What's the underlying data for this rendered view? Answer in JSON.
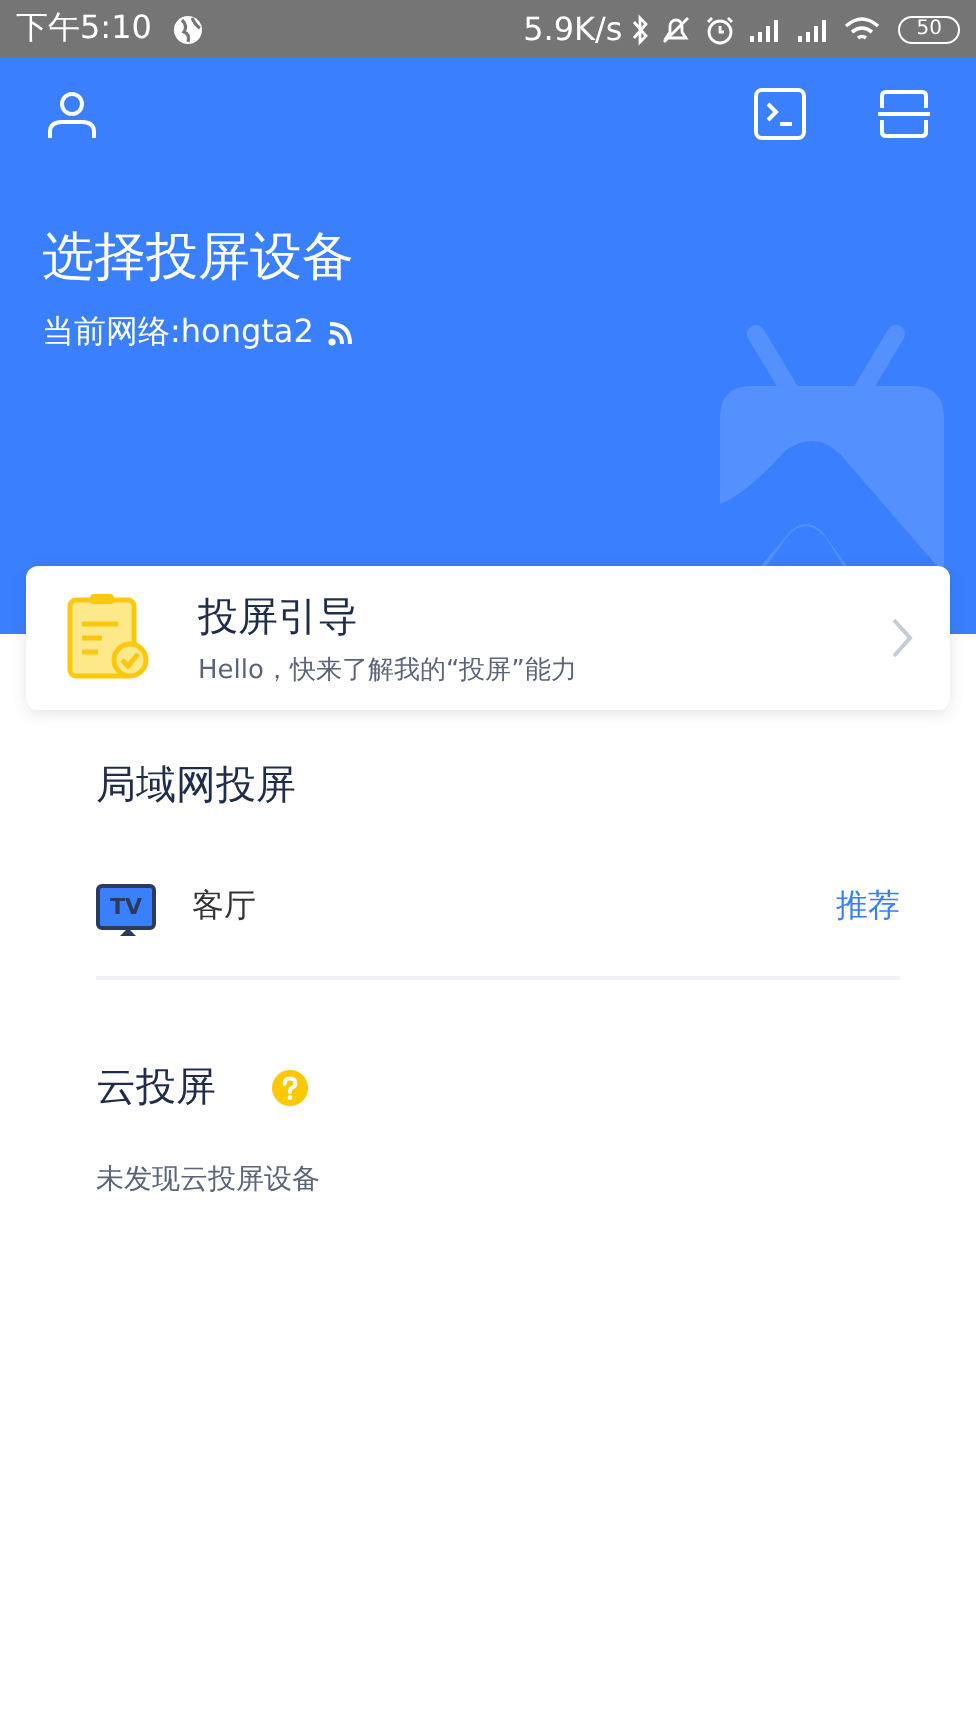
{
  "status_bar": {
    "time": "下午5:10",
    "speed": "5.9K/s",
    "battery": "50"
  },
  "header": {
    "title": "选择投屏设备",
    "network": "当前网络:hongta2"
  },
  "guide_card": {
    "title": "投屏引导",
    "subtitle": "Hello，快来了解我的“投屏”能力"
  },
  "lan_section": {
    "title": "局域网投屏",
    "devices": [
      {
        "name": "客厅",
        "icon_label": "TV",
        "tag": "推荐"
      }
    ]
  },
  "cloud_section": {
    "title": "云投屏",
    "empty_text": "未发现云投屏设备"
  }
}
